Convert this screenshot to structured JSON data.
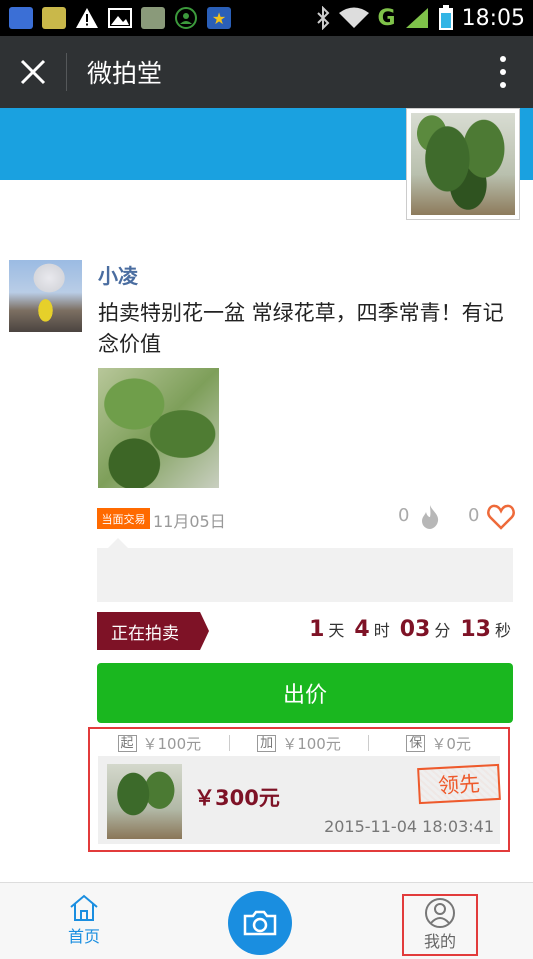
{
  "status_bar": {
    "time": "18:05",
    "network": "G"
  },
  "titlebar": {
    "title": "微拍堂"
  },
  "post": {
    "username": "小凌",
    "text": "拍卖特别花一盆   常绿花草，四季常青！有记念价值",
    "trade_badge": "当面交易",
    "date": "11月05日",
    "hot_count": "0",
    "like_count": "0"
  },
  "auction": {
    "status_label": "正在拍卖",
    "countdown": {
      "days": "1",
      "days_unit": "天",
      "hours": "4",
      "hours_unit": "时",
      "minutes": "03",
      "minutes_unit": "分",
      "seconds": "13",
      "seconds_unit": "秒"
    },
    "bid_button_label": "出价"
  },
  "bid_record": {
    "terms": [
      {
        "key": "起",
        "value": "￥100元"
      },
      {
        "key": "加",
        "value": "￥100元"
      },
      {
        "key": "保",
        "value": "￥0元"
      }
    ],
    "price": "￥300元",
    "stamp": "领先",
    "time": "2015-11-04 18:03:41"
  },
  "bottom_nav": {
    "home_label": "首页",
    "mine_label": "我的"
  },
  "colors": {
    "accent_blue": "#1a8ee0",
    "banner": "#1aa1e0",
    "bid_green": "#1ab71f",
    "auction_red": "#7e1226"
  }
}
